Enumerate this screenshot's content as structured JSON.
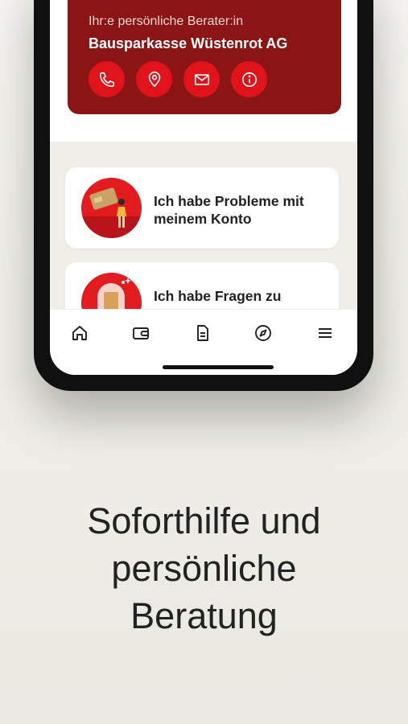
{
  "advisor": {
    "label": "Ihr:e persönliche Berater:in",
    "name": "Bausparkasse Wüstenrot AG",
    "actions": [
      "phone-icon",
      "location-pin-icon",
      "mail-icon",
      "info-icon"
    ]
  },
  "help_items": [
    {
      "text_line1": "Ich habe Probleme mit",
      "text_line2": "meinem Konto",
      "icon": "account-problem-illustration"
    },
    {
      "text_line1": "Ich habe Fragen zu",
      "text_line2": "",
      "icon": "questions-illustration"
    }
  ],
  "tabbar": [
    "home-icon",
    "wallet-icon",
    "document-icon",
    "compass-icon",
    "menu-icon"
  ],
  "headline": {
    "line1": "Soforthilfe und",
    "line2": "persönliche",
    "line3": "Beratung"
  },
  "colors": {
    "brand_dark": "#8b1414",
    "brand_red": "#e0121a"
  }
}
